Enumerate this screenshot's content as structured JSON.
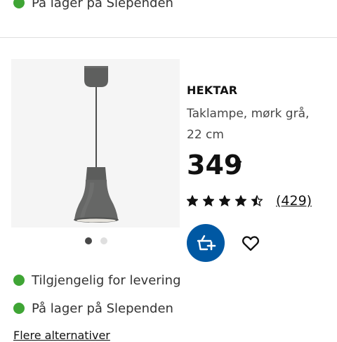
{
  "availability_top": {
    "label": "På lager på Slependen",
    "status_color": "#3fa535"
  },
  "product": {
    "brand": "HEKTAR",
    "description": "Taklampe, mørk grå, 22 cm",
    "price": "349",
    "price_suffix": ",-",
    "rating": {
      "stars": 4.5,
      "max": 5,
      "review_count": "(429)"
    },
    "image_carousel": {
      "count": 2,
      "active_index": 0
    }
  },
  "actions": {
    "add_to_cart_icon": "basket-plus-icon",
    "wishlist_icon": "heart-icon"
  },
  "availability": [
    {
      "label": "Tilgjengelig for levering",
      "status_color": "#3fa535"
    },
    {
      "label": "På lager på Slependen",
      "status_color": "#3fa535"
    }
  ],
  "more_options_label": "Flere alternativer",
  "colors": {
    "primary_blue": "#0058a3",
    "stock_green": "#3fa535"
  }
}
